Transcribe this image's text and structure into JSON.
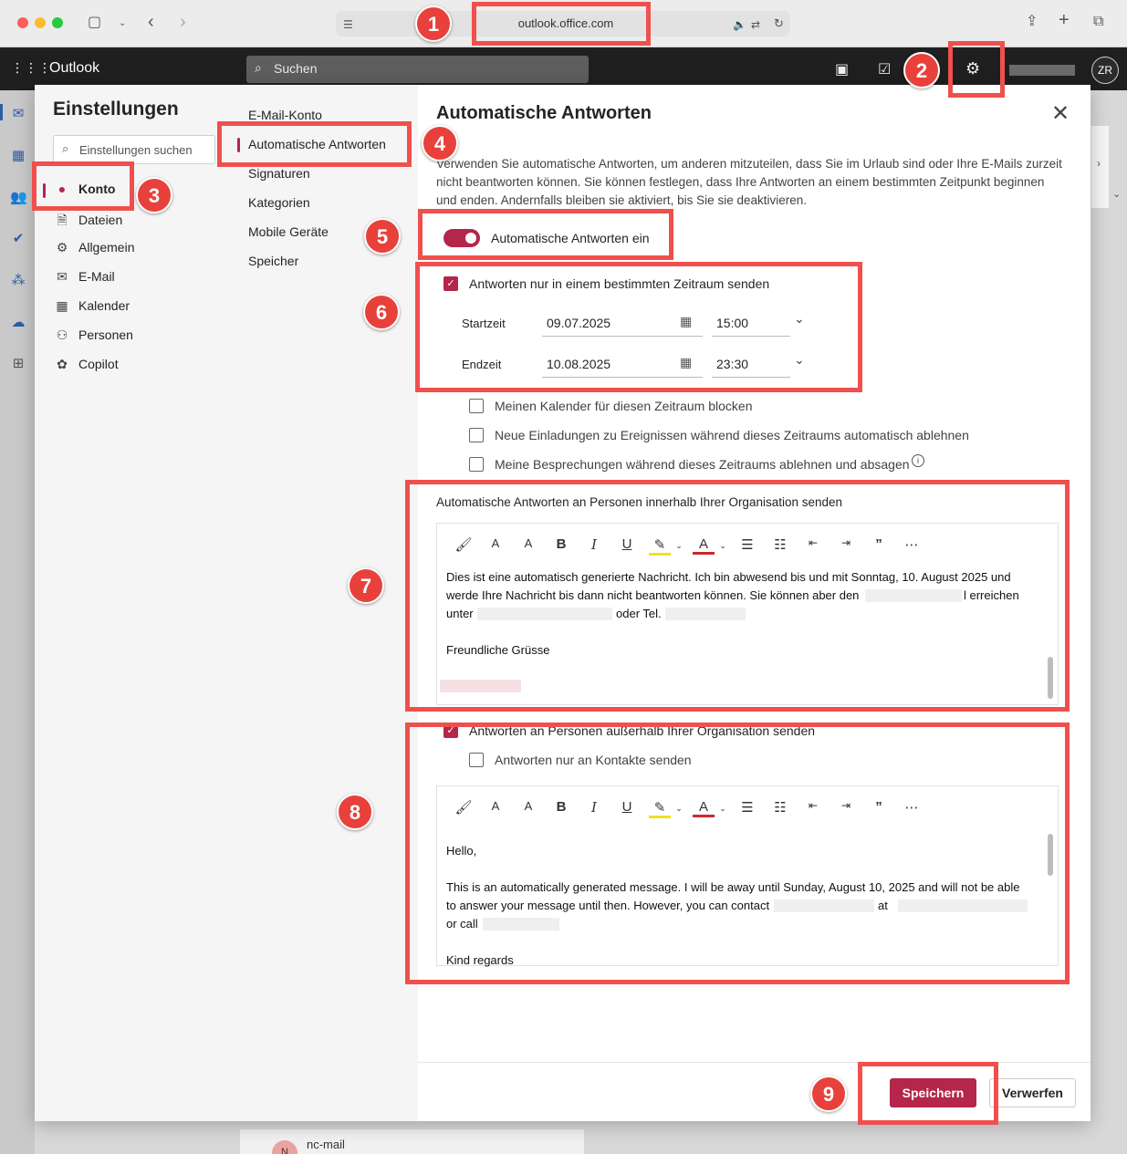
{
  "browser": {
    "url": "outlook.office.com"
  },
  "topbar": {
    "app_title": "Outlook",
    "search_placeholder": "Suchen",
    "user_initials": "ZR"
  },
  "settings": {
    "title": "Einstellungen",
    "search_placeholder": "Einstellungen suchen",
    "nav": [
      {
        "label": "Konto",
        "icon": "person-icon",
        "selected": true
      },
      {
        "label": "Dateien",
        "icon": "file-icon"
      },
      {
        "label": "Allgemein",
        "icon": "gear-icon"
      },
      {
        "label": "E-Mail",
        "icon": "mail-icon"
      },
      {
        "label": "Kalender",
        "icon": "calendar-icon"
      },
      {
        "label": "Personen",
        "icon": "people-icon"
      },
      {
        "label": "Copilot",
        "icon": "copilot-icon"
      }
    ],
    "subnav": [
      {
        "label": "E-Mail-Konto"
      },
      {
        "label": "Automatische Antworten",
        "selected": true
      },
      {
        "label": "Signaturen"
      },
      {
        "label": "Kategorien"
      },
      {
        "label": "Mobile Geräte"
      },
      {
        "label": "Speicher"
      }
    ]
  },
  "panel": {
    "title": "Automatische Antworten",
    "description": "Verwenden Sie automatische Antworten, um anderen mitzuteilen, dass Sie im Urlaub sind oder Ihre E-Mails zurzeit nicht beantworten können. Sie können festlegen, dass Ihre Antworten an einem bestimmten Zeitpunkt beginnen und enden. Andernfalls bleiben sie aktiviert, bis Sie sie deaktivieren.",
    "toggle_label": "Automatische Antworten ein",
    "toggle_on": true,
    "timeframe_label": "Antworten nur in einem bestimmten Zeitraum senden",
    "start_label": "Startzeit",
    "start_date": "09.07.2025",
    "start_time": "15:00",
    "end_label": "Endzeit",
    "end_date": "10.08.2025",
    "end_time": "23:30",
    "opt_block_calendar": "Meinen Kalender für diesen Zeitraum blocken",
    "opt_decline_invites": "Neue Einladungen zu Ereignissen während dieses Zeitraums automatisch ablehnen",
    "opt_cancel_meetings": "Meine Besprechungen während dieses Zeitraums ablehnen und absagen",
    "internal_label": "Automatische Antworten an Personen innerhalb Ihrer Organisation senden",
    "internal_line1": "Dies ist eine automatisch generierte Nachricht. Ich bin abwesend bis und mit Sonntag, 10. August 2025 und",
    "internal_line2a": "werde Ihre Nachricht bis dann nicht beantworten können. Sie können aber den",
    "internal_line2b": "l erreichen",
    "internal_line3a": "unter",
    "internal_line3b": "oder Tel.",
    "internal_closing": "Freundliche Grüsse",
    "external_label": "Antworten an Personen außerhalb Ihrer Organisation senden",
    "external_contacts_only": "Antworten nur an Kontakte senden",
    "external_greeting": "Hello,",
    "external_line1": "This is an automatically generated message. I will be away until Sunday, August 10, 2025 and will not be able",
    "external_line2a": "to answer your message until then. However, you can contact",
    "external_line2b": "at",
    "external_line3a": "or call",
    "external_closing": "Kind regards",
    "save_label": "Speichern",
    "discard_label": "Verwerfen"
  },
  "behind": {
    "mail_sender": "nc-mail",
    "sender_initial": "N"
  },
  "annotations": [
    "1",
    "2",
    "3",
    "4",
    "5",
    "6",
    "7",
    "8",
    "9"
  ],
  "colors": {
    "accent": "#b4264a",
    "annotation_red": "#f0504d"
  }
}
